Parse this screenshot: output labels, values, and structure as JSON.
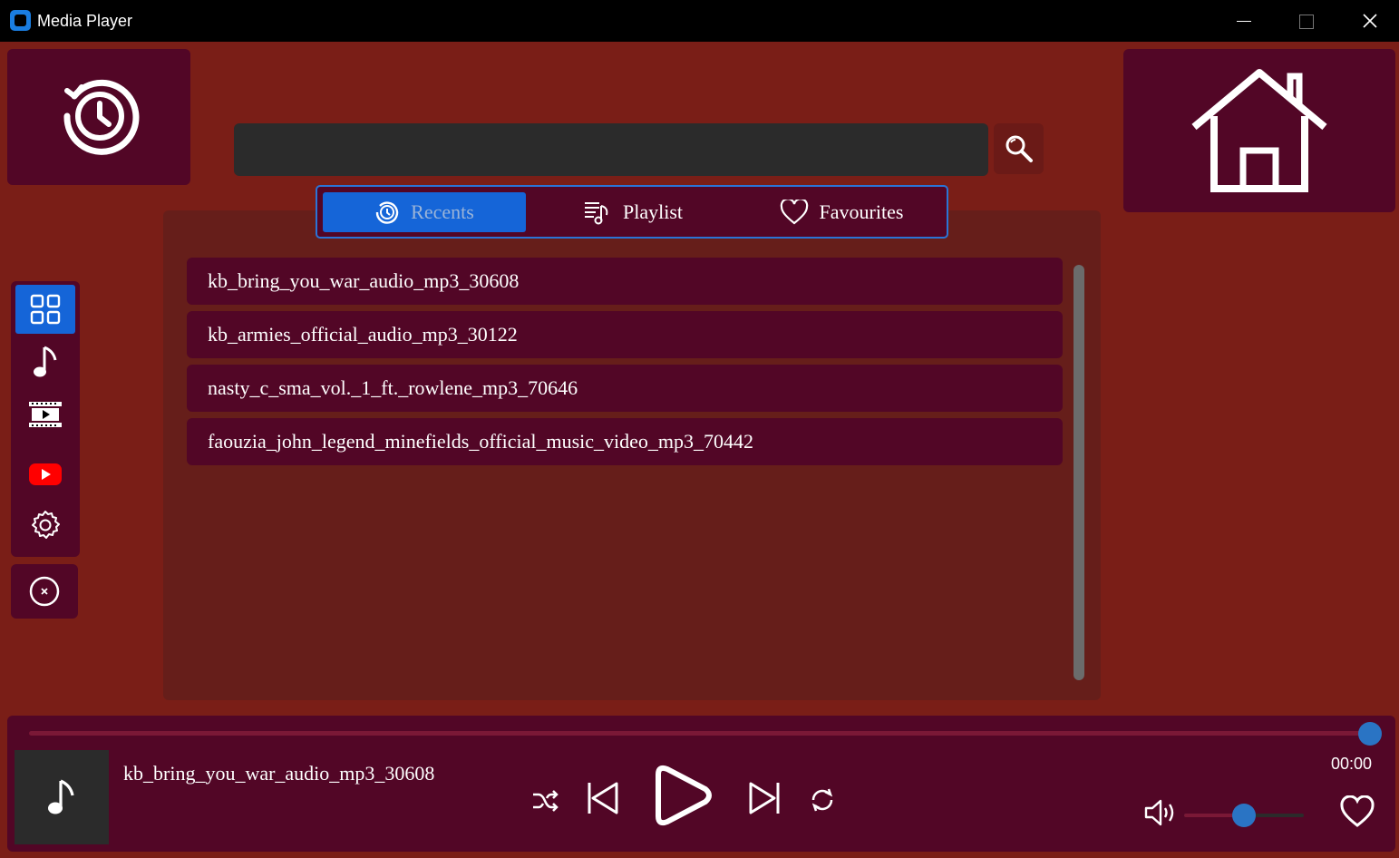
{
  "window": {
    "title": "Media Player"
  },
  "search": {
    "value": "",
    "placeholder": ""
  },
  "tabs": [
    {
      "label": "Recents",
      "icon": "history-icon",
      "active": true
    },
    {
      "label": "Playlist",
      "icon": "playlist-icon",
      "active": false
    },
    {
      "label": "Favourites",
      "icon": "heart-icon",
      "active": false
    }
  ],
  "tracks": [
    "kb_bring_you_war_audio_mp3_30608",
    "kb_armies_official_audio_mp3_30122",
    "nasty_c_sma_vol._1_ft._rowlene_mp3_70646",
    "faouzia_john_legend_minefields_official_music_video_mp3_70442"
  ],
  "sidebar": {
    "items": [
      {
        "name": "dashboard",
        "icon": "grid-icon",
        "active": true
      },
      {
        "name": "music",
        "icon": "music-note-icon",
        "active": false
      },
      {
        "name": "video",
        "icon": "film-icon",
        "active": false
      },
      {
        "name": "youtube",
        "icon": "youtube-icon",
        "active": false
      },
      {
        "name": "settings",
        "icon": "gear-icon",
        "active": false
      }
    ]
  },
  "player": {
    "now_playing": "kb_bring_you_war_audio_mp3_30608",
    "time": "00:00",
    "progress": 1.0,
    "volume": 0.5
  },
  "colors": {
    "background": "#7a1e17",
    "panel": "#520626",
    "accent": "#1565d8",
    "knob": "#2a74c4"
  }
}
